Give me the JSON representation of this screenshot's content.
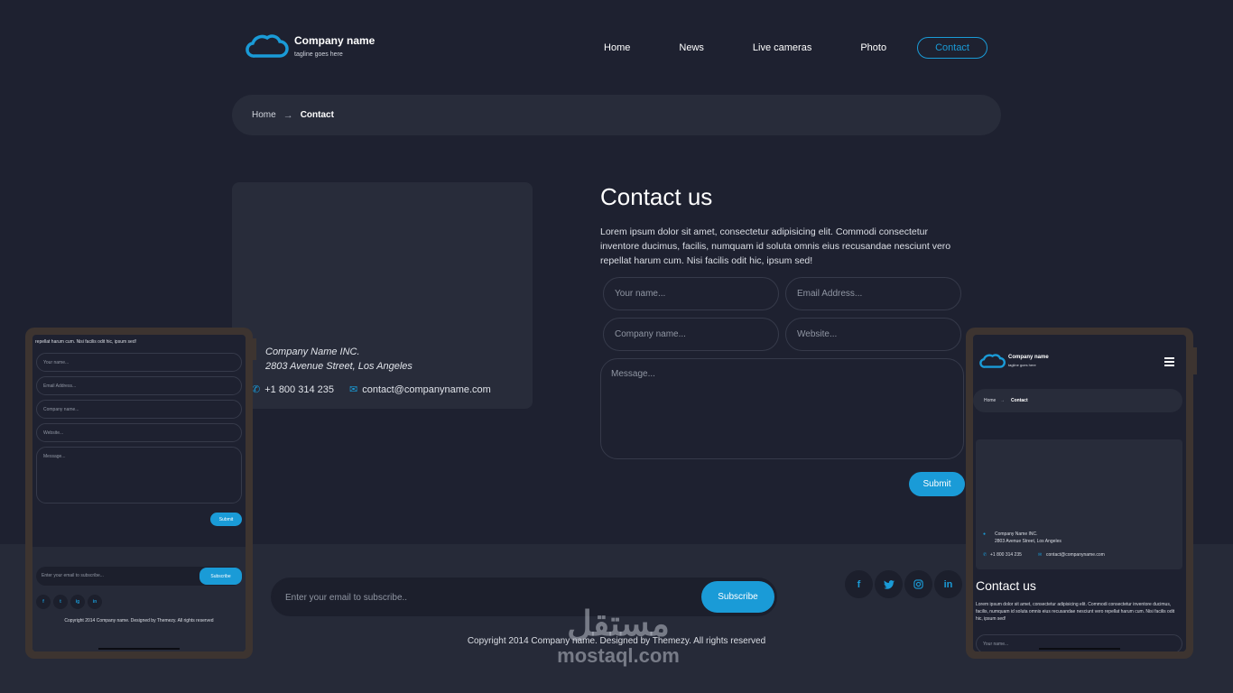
{
  "header": {
    "brand_name": "Company name",
    "tagline": "tagline goes here",
    "nav": [
      {
        "label": "Home"
      },
      {
        "label": "News"
      },
      {
        "label": "Live cameras"
      },
      {
        "label": "Photo"
      },
      {
        "label": "Contact",
        "active": true
      }
    ]
  },
  "breadcrumb": {
    "home": "Home",
    "separator": "→",
    "current": "Contact"
  },
  "info_card": {
    "company": "Company Name INC.",
    "address": "2803 Avenue Street, Los Angeles",
    "phone": "+1 800 314 235",
    "email": "contact@companyname.com"
  },
  "contact": {
    "title": "Contact us",
    "description": "Lorem ipsum dolor sit amet, consectetur adipisicing elit. Commodi consectetur inventore ducimus, facilis, numquam id soluta omnis eius recusandae nesciunt vero repellat harum cum. Nisi facilis odit hic, ipsum sed!",
    "placeholders": {
      "name": "Your name...",
      "email": "Email Address...",
      "company": "Company name...",
      "website": "Website...",
      "message": "Message..."
    },
    "submit_label": "Submit"
  },
  "footer": {
    "subscribe_placeholder": "Enter your email to subscribe..",
    "subscribe_label": "Subscribe",
    "socials": [
      "f",
      "t",
      "ig",
      "in"
    ],
    "copyright": "Copyright 2014 Company name. Designed by Themezy. All rights reserved"
  },
  "watermark": {
    "arabic": "مستقل",
    "latin": "mostaql.com"
  },
  "mobile_left": {
    "top_text": "repellat harum cum. Nisi facilis odit hic, ipsum sed!",
    "placeholders": [
      "Your name...",
      "Email Address...",
      "Company name...",
      "Website...",
      "Message..."
    ],
    "submit_label": "Submit",
    "subscribe_placeholder": "Enter your email to subscribe...",
    "subscribe_label": "Subscribe",
    "copyright": "Copyright 2014 Company name. Designed by Themezy. All rights reserved"
  },
  "mobile_right": {
    "brand_name": "Company name",
    "tagline": "tagline goes here",
    "breadcrumb_home": "Home",
    "breadcrumb_sep": "→",
    "breadcrumb_current": "Contact",
    "company": "Company Name INC.",
    "address": "2803 Avenue Street, Los Angeles",
    "phone": "+1 800 314 235",
    "email": "contact@companyname.com",
    "title": "Contact us",
    "description": "Lorem ipsum dolor sit amet, consectetur adipisicing elit. Commodi consectetur inventore ducimus, facilis, numquam id soluta omnis eius recusandae nesciunt vero repellat harum cum. Nisi facilis odit hic, ipsum sed!",
    "name_placeholder": "Your name..."
  },
  "colors": {
    "accent": "#1a9bd7",
    "background": "#1e2130",
    "card": "#282c3a",
    "footer": "#262a38"
  }
}
